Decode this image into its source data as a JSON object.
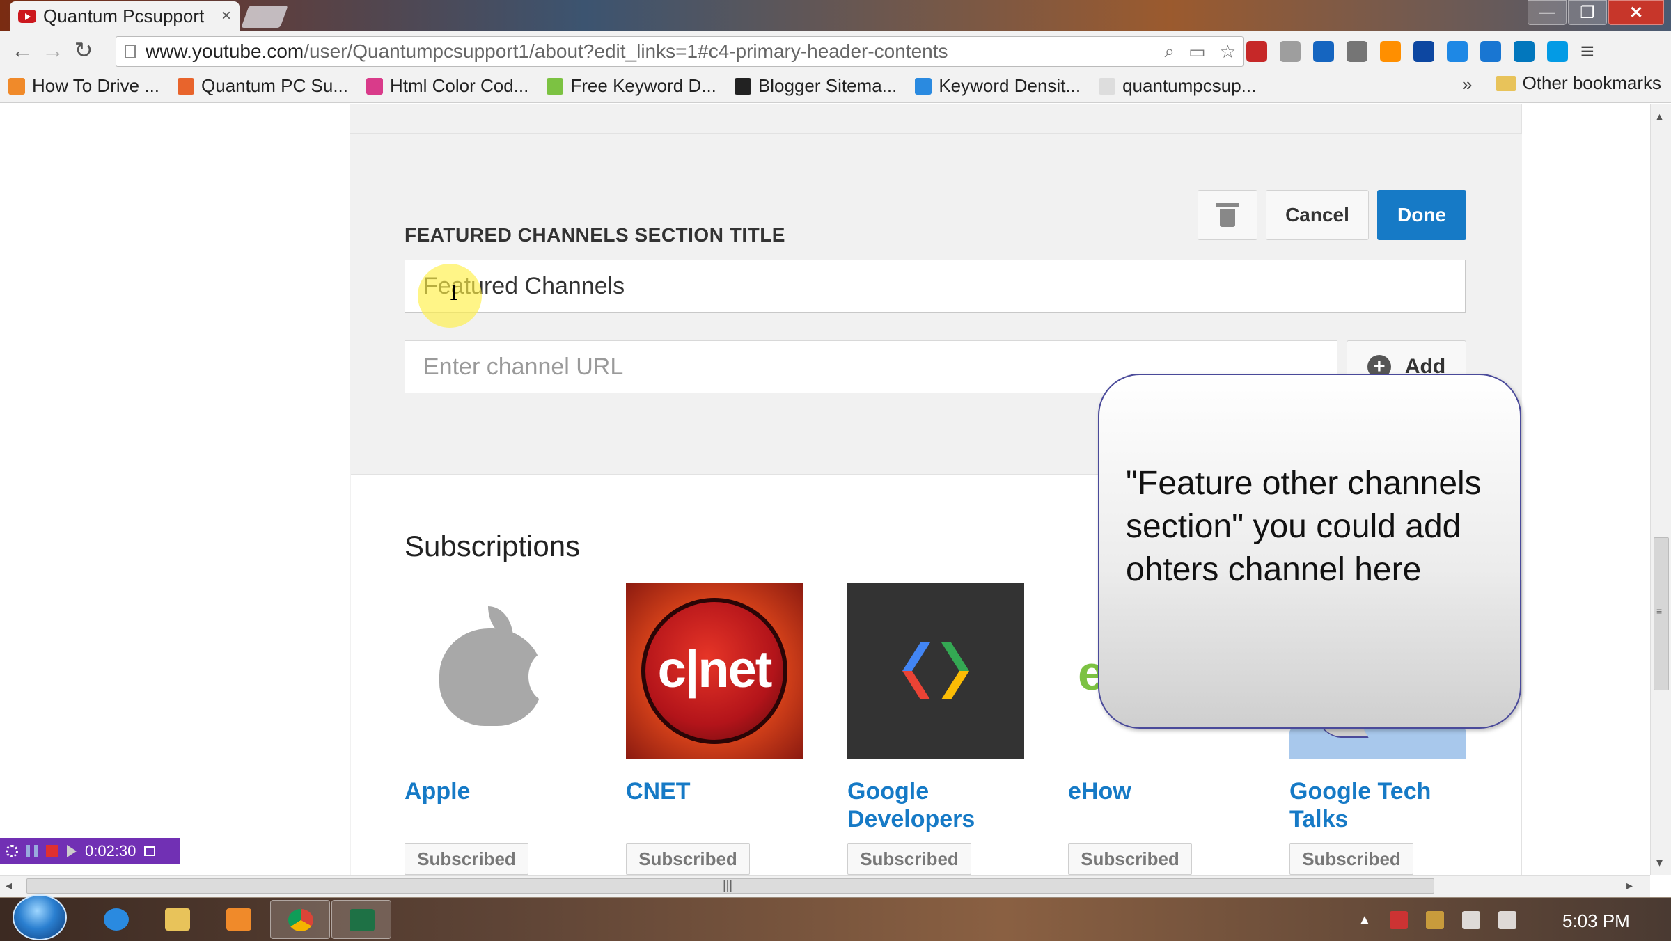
{
  "browser": {
    "tab_title": "Quantum Pcsupport",
    "tab_close": "×",
    "url_host": "www.youtube.com",
    "url_path": "/user/Quantumpcsupport1/about?edit_links=1#c4-primary-header-contents",
    "window_buttons": {
      "minimize": "—",
      "maximize": "❐",
      "close": "✕"
    },
    "nav": {
      "back": "←",
      "forward": "→",
      "reload": "↻"
    },
    "bookmarks": [
      {
        "label": "How To Drive ...",
        "color": "#f08a2a"
      },
      {
        "label": "Quantum PC Su...",
        "color": "#e8642c"
      },
      {
        "label": "Html Color Cod...",
        "color": "#d93b8a"
      },
      {
        "label": "Free Keyword D...",
        "color": "#7cc242"
      },
      {
        "label": "Blogger Sitema...",
        "color": "#222222"
      },
      {
        "label": "Keyword Densit...",
        "color": "#2a8ae0"
      },
      {
        "label": "quantumpcsup...",
        "color": "#dddddd"
      }
    ],
    "bookmarks_more": "»",
    "other_bookmarks": "Other bookmarks",
    "extension_colors": [
      "#c62828",
      "#9e9e9e",
      "#1565c0",
      "#757575",
      "#ff8f00",
      "#0d47a1",
      "#1e88e5",
      "#1976d2",
      "#0277bd",
      "#039be5"
    ]
  },
  "editor": {
    "section_label": "FEATURED CHANNELS SECTION TITLE",
    "cancel_label": "Cancel",
    "done_label": "Done",
    "title_value": "Featured Channels",
    "text_cursor": "I",
    "url_placeholder": "Enter channel URL",
    "add_label": "Add",
    "add_icon": "+"
  },
  "subscriptions": {
    "heading": "Subscriptions",
    "channels": [
      {
        "name": "Apple",
        "button": "Subscribed"
      },
      {
        "name": "CNET",
        "logo_text": "c|net",
        "button": "Subscribed"
      },
      {
        "name": "Google Developers",
        "button": "Subscribed"
      },
      {
        "name": "eHow",
        "logo_text": "e",
        "button": "Subscribed"
      },
      {
        "name": "Google Tech Talks",
        "button": "Subscribed"
      }
    ]
  },
  "callout": {
    "text": "\"Feature other channels section\"  you could add ohters channel here"
  },
  "recorder": {
    "time": "0:02:30"
  },
  "scrollbar": {
    "grip": "|||",
    "left_arrow": "◂",
    "right_arrow": "▸",
    "up_arrow": "▴",
    "down_arrow": "▾"
  },
  "taskbar": {
    "clock": "5:03 PM",
    "tray_up": "▲",
    "apps": [
      "internet-explorer",
      "file-explorer",
      "media-player",
      "chrome",
      "excel"
    ]
  },
  "colors": {
    "accent_blue": "#167ac6",
    "recorder_purple": "#7130b4",
    "highlight_yellow": "#fff046"
  }
}
